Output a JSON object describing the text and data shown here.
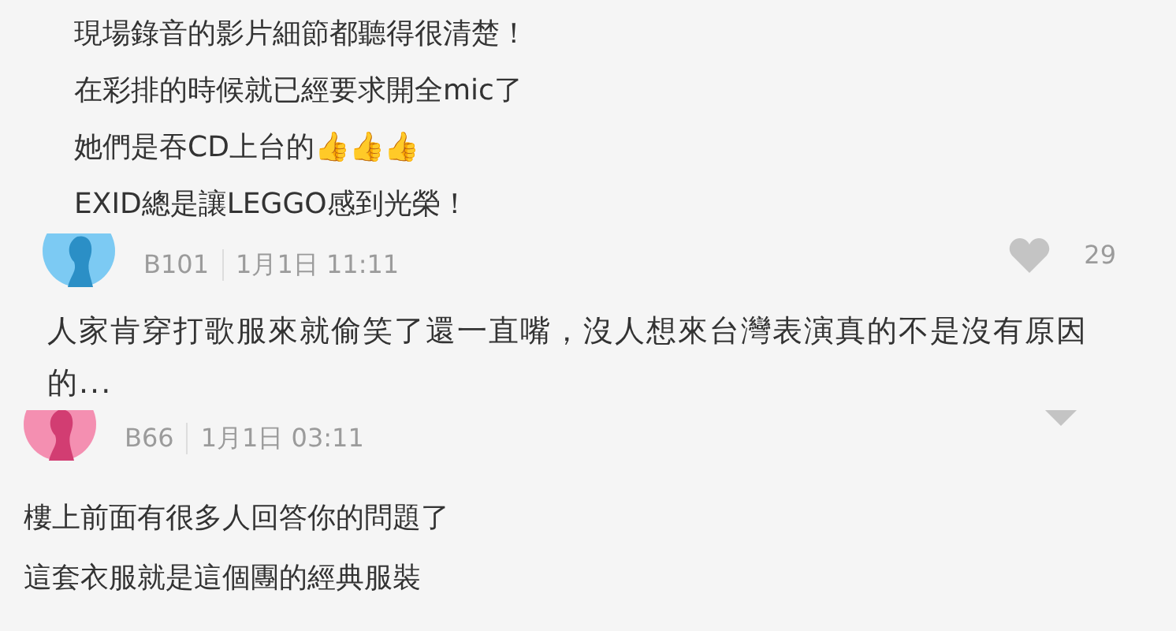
{
  "post_lines": [
    "現場錄音的影片細節都聽得很清楚！",
    "在彩排的時候就已經要求開全mic了",
    "她們是吞CD上台的👍👍👍",
    "EXID總是讓LEGGO感到光榮！"
  ],
  "comments": [
    {
      "author": "B101",
      "time": "1月1日 11:11",
      "likes": "29",
      "color": "#7ccaf3",
      "text": "人家肯穿打歌服來就偷笑了還一直嘴，沒人想來台灣表演真的不是沒有原因的..."
    },
    {
      "author": "B66",
      "time": "1月1日 03:11",
      "color": "#f48fb1",
      "lines": [
        "樓上前面有很多人回答你的問題了",
        "這套衣服就是這個團的經典服裝"
      ]
    }
  ]
}
